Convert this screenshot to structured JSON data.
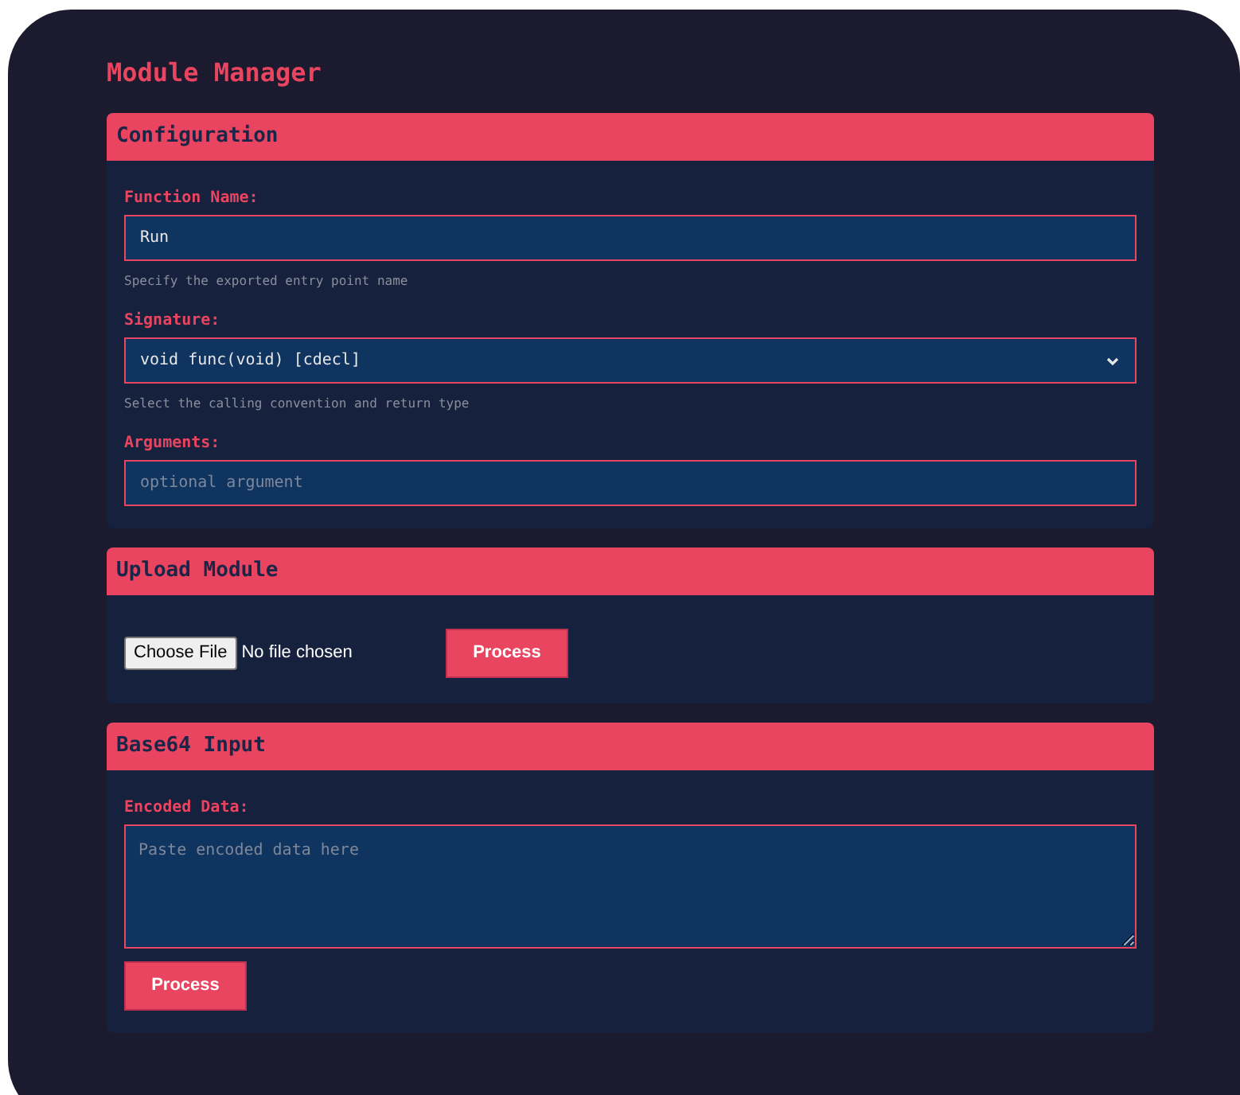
{
  "title": "Module Manager",
  "configuration": {
    "header": "Configuration",
    "fields": [
      {
        "kind": "text",
        "label": "Function Name:",
        "value": "Run",
        "hint": "Specify the exported entry point name"
      },
      {
        "kind": "select",
        "label": "Signature:",
        "value": "void func(void) [cdecl]",
        "hint": "Select the calling convention and return type"
      },
      {
        "kind": "text",
        "label": "Arguments:",
        "placeholder": "optional argument"
      }
    ]
  },
  "upload": {
    "header": "Upload Module",
    "choose_button": "Choose File",
    "file_status": "No file chosen",
    "button": "Process"
  },
  "base64": {
    "header": "Base64 Input",
    "label": "Encoded Data:",
    "placeholder": "Paste encoded data here",
    "button": "Process"
  }
}
